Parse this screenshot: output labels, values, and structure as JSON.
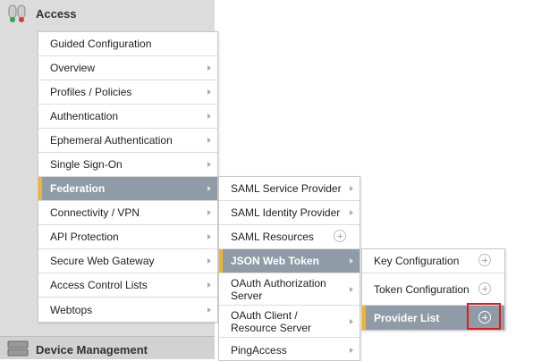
{
  "nav": {
    "access_title": "Access",
    "device_management_title": "Device Management"
  },
  "menu_l1": [
    {
      "label": "Guided Configuration",
      "submenu": false
    },
    {
      "label": "Overview",
      "submenu": true
    },
    {
      "label": "Profiles / Policies",
      "submenu": true
    },
    {
      "label": "Authentication",
      "submenu": true
    },
    {
      "label": "Ephemeral Authentication",
      "submenu": true
    },
    {
      "label": "Single Sign-On",
      "submenu": true
    },
    {
      "label": "Federation",
      "submenu": true,
      "selected": true
    },
    {
      "label": "Connectivity / VPN",
      "submenu": true
    },
    {
      "label": "API Protection",
      "submenu": true
    },
    {
      "label": "Secure Web Gateway",
      "submenu": true
    },
    {
      "label": "Access Control Lists",
      "submenu": true
    },
    {
      "label": "Webtops",
      "submenu": true
    }
  ],
  "menu_l2": [
    {
      "label": "SAML Service Provider",
      "submenu": true
    },
    {
      "label": "SAML Identity Provider",
      "submenu": true
    },
    {
      "label": "SAML Resources",
      "add": true
    },
    {
      "label": "JSON Web Token",
      "submenu": true,
      "selected": true
    },
    {
      "label": "OAuth Authorization Server",
      "submenu": true,
      "tall": true
    },
    {
      "label": "OAuth Client / Resource Server",
      "submenu": true,
      "tall": true
    },
    {
      "label": "PingAccess",
      "submenu": true
    }
  ],
  "menu_l3": [
    {
      "label": "Key Configuration",
      "add": true
    },
    {
      "label": "Token Configuration",
      "add": true,
      "tall": true
    },
    {
      "label": "Provider List",
      "add": true,
      "selected": true,
      "highlighted": true
    }
  ],
  "colors": {
    "selected_bg": "#8f9ca7",
    "selected_accent": "#f0b429",
    "highlight": "#e01b1b",
    "nav_bg": "#dcdcdc"
  }
}
